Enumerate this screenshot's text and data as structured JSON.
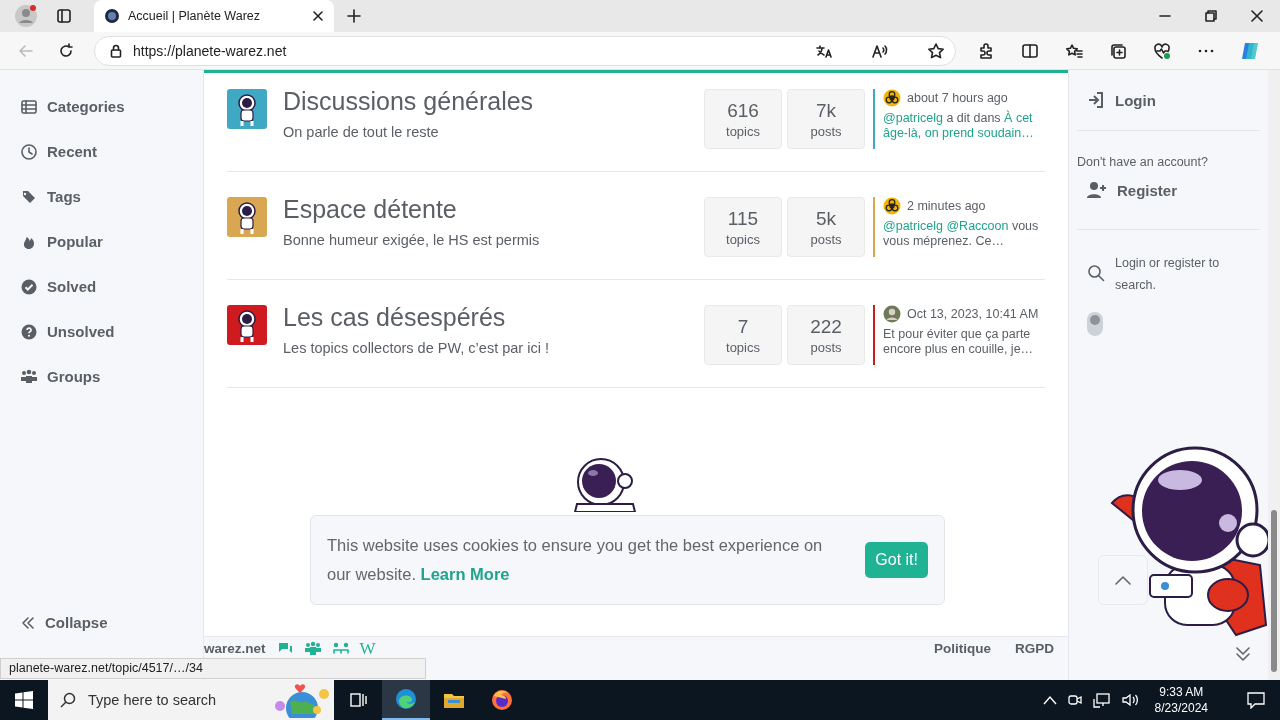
{
  "browser": {
    "tabs": [
      {
        "title": "Accueil | Planète Warez",
        "selected": true
      }
    ],
    "url": "https://planete-warez.net"
  },
  "sidebar": {
    "items": [
      {
        "label": "Categories"
      },
      {
        "label": "Recent"
      },
      {
        "label": "Tags"
      },
      {
        "label": "Popular"
      },
      {
        "label": "Solved"
      },
      {
        "label": "Unsolved"
      },
      {
        "label": "Groups"
      }
    ],
    "collapse": "Collapse"
  },
  "categories": [
    {
      "name": "Discussions générales",
      "description": "On parle de tout le reste",
      "color": "#3fa9c4",
      "topics": "616",
      "topics_label": "topics",
      "posts": "7k",
      "posts_label": "posts",
      "teaser": {
        "time": "about 7 hours ago",
        "parts": [
          {
            "text": "@patricelg",
            "kind": "link"
          },
          {
            "text": " a dit dans ",
            "kind": "plain"
          },
          {
            "text": "À cet âge-là, on prend soudain…",
            "kind": "link"
          }
        ]
      }
    },
    {
      "name": "Espace détente",
      "description": "Bonne humeur exigée, le HS est permis",
      "color": "#d9a752",
      "topics": "115",
      "topics_label": "topics",
      "posts": "5k",
      "posts_label": "posts",
      "teaser": {
        "time": "2 minutes ago",
        "parts": [
          {
            "text": "@patricelg @Raccoon",
            "kind": "link"
          },
          {
            "text": " vous vous méprenez. Ce…",
            "kind": "plain"
          }
        ]
      }
    },
    {
      "name": "Les cas désespérés",
      "description": "Les topics collectors de PW, c’est par ici !",
      "color": "#cf1a1f",
      "topics": "7",
      "topics_label": "topics",
      "posts": "222",
      "posts_label": "posts",
      "teaser": {
        "time": "Oct 13, 2023, 10:41 AM",
        "parts": [
          {
            "text": "Et pour éviter que ça parte encore plus en couille, je…",
            "kind": "plain"
          }
        ]
      }
    }
  ],
  "right_panel": {
    "login": "Login",
    "prompt": "Don't have an account?",
    "register": "Register",
    "search_hint": "Login or register to search.",
    "search_toggle": {
      "on": false
    }
  },
  "cookie": {
    "message": "This website uses cookies to ensure you get the best experience on our website.",
    "link": "Learn More",
    "button": "Got it!"
  },
  "footer": {
    "brand": "warez.net",
    "wiki_glyph": "W",
    "links": [
      "Politique",
      "RGPD"
    ]
  },
  "status_url": "planete-warez.net/topic/4517/…/34",
  "taskbar": {
    "search_placeholder": "Type here to search",
    "apps": [
      {
        "selected": true
      },
      {
        "selected": false
      },
      {
        "selected": false
      }
    ],
    "time": "9:33 AM",
    "date": "8/23/2024"
  }
}
